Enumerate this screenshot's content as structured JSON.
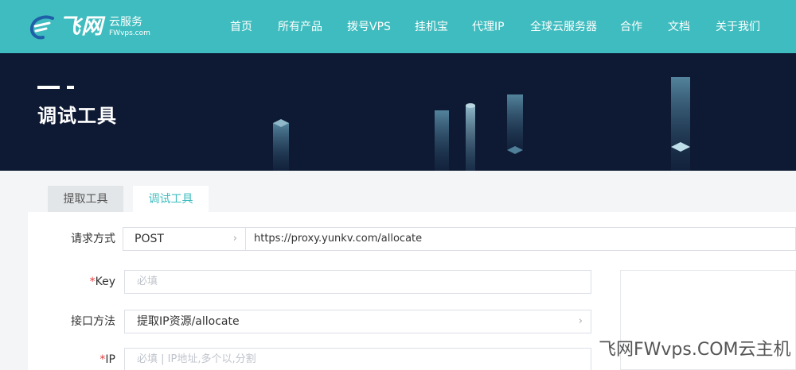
{
  "brand": {
    "name_cn": "飞网",
    "sub_cn": "云服务",
    "sub_en": "FWvps.com"
  },
  "nav": [
    {
      "label": "首页"
    },
    {
      "label": "所有产品"
    },
    {
      "label": "拨号VPS"
    },
    {
      "label": "挂机宝"
    },
    {
      "label": "代理IP"
    },
    {
      "label": "全球云服务器"
    },
    {
      "label": "合作"
    },
    {
      "label": "文档"
    },
    {
      "label": "关于我们"
    }
  ],
  "banner": {
    "title": "调试工具"
  },
  "tabs": [
    {
      "label": "提取工具",
      "active": false
    },
    {
      "label": "调试工具",
      "active": true
    }
  ],
  "form": {
    "method": {
      "label": "请求方式",
      "value": "POST",
      "url": "https://proxy.yunkv.com/allocate"
    },
    "key": {
      "required_mark": "*",
      "label": "Key",
      "placeholder": "必填"
    },
    "endpoint": {
      "label": "接口方法",
      "value": "提取IP资源/allocate"
    },
    "ip": {
      "required_mark": "*",
      "label": "IP",
      "placeholder": "必填 | IP地址,多个以,分割"
    }
  },
  "watermark": "飞网FWvps.COM云主机",
  "colors": {
    "header_bg": "#3fbcbf",
    "banner_bg": "#0e1a33",
    "accent": "#3fbcbf",
    "required": "#e4393c"
  },
  "icons": {
    "chevron": "chevron-right-icon"
  }
}
